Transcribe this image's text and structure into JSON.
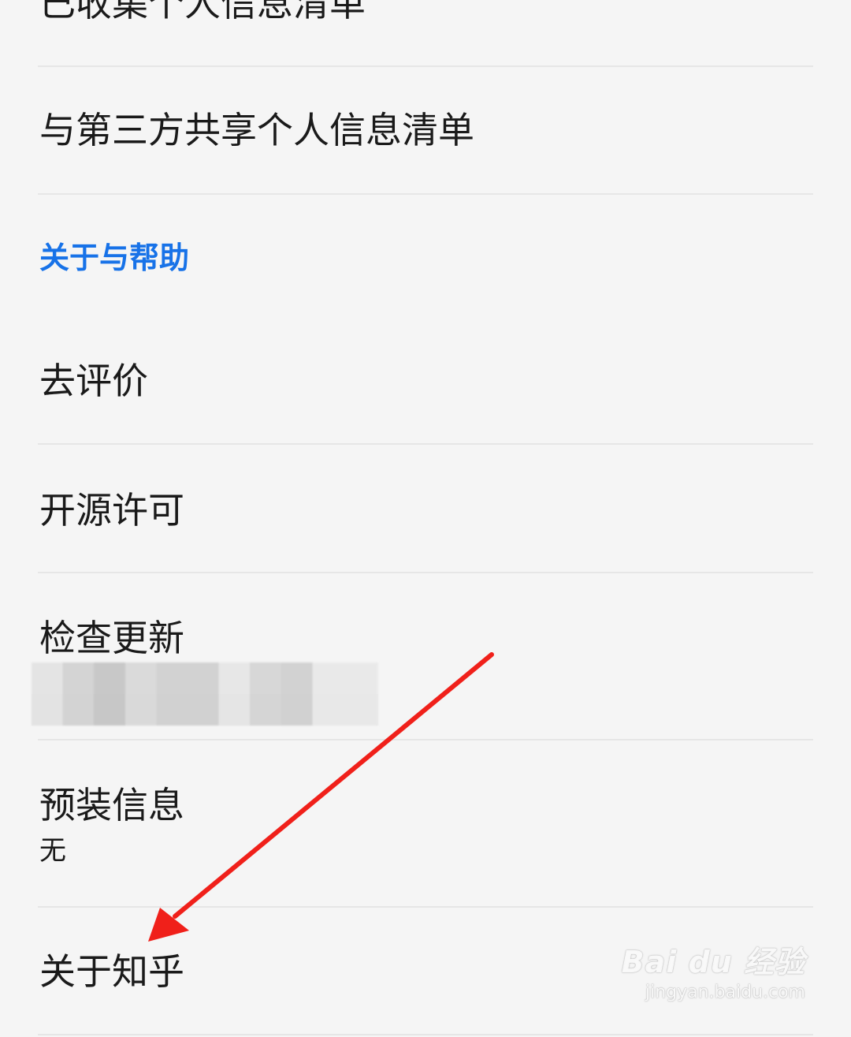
{
  "privacy_items": {
    "collected_list": "已收集个人信息清单",
    "shared_list": "与第三方共享个人信息清单"
  },
  "about_section": {
    "header": "关于与帮助",
    "rate": "去评价",
    "open_source": "开源许可",
    "check_update": "检查更新",
    "preinstall": "预装信息",
    "preinstall_value": "无",
    "about_zhihu": "关于知乎"
  },
  "watermark": {
    "logo": "Bai du 经验",
    "url": "jingyan.baidu.com"
  },
  "colors": {
    "background": "#f5f5f5",
    "section_header": "#1772e8",
    "text": "#1a1a1a",
    "divider": "#e6e6e6",
    "annotation_arrow": "#f0201a"
  }
}
